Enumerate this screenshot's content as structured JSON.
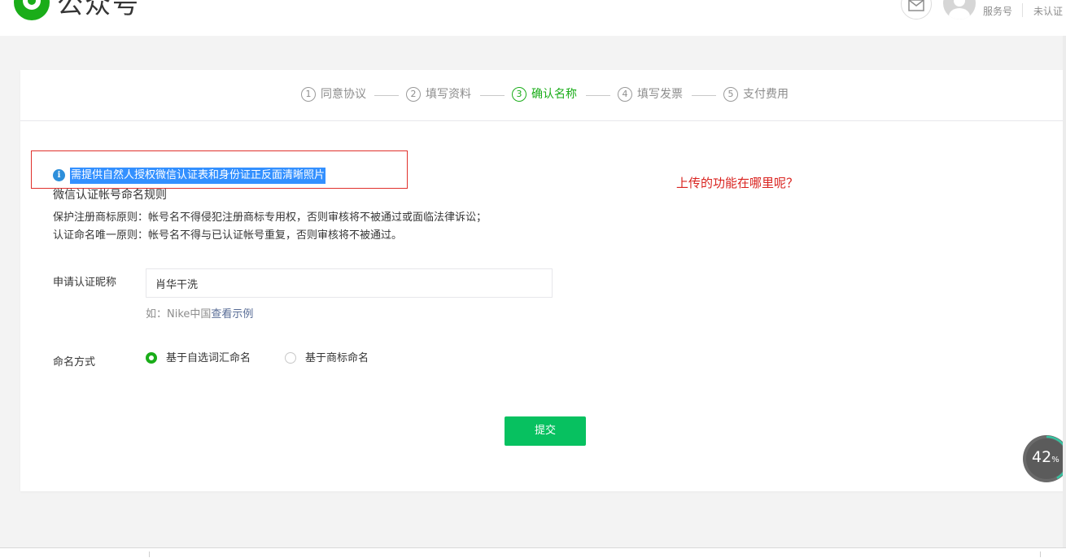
{
  "header": {
    "brand": "公众号",
    "account_type": "服务号",
    "account_status": "未认证"
  },
  "steps": [
    {
      "num": "1",
      "label": "同意协议",
      "active": false
    },
    {
      "num": "2",
      "label": "填写资料",
      "active": false
    },
    {
      "num": "3",
      "label": "确认名称",
      "active": true
    },
    {
      "num": "4",
      "label": "填写发票",
      "active": false
    },
    {
      "num": "5",
      "label": "支付费用",
      "active": false
    }
  ],
  "notice": {
    "text": "需提供自然人授权微信认证表和身份证正反面清晰照片"
  },
  "annotation": "上传的功能在哪里呢？",
  "rules": {
    "title": "微信认证帐号命名规则",
    "lines": [
      "保护注册商标原则：帐号名不得侵犯注册商标专用权，否则审核将不被通过或面临法律诉讼；",
      "认证命名唯一原则：帐号名不得与已认证帐号重复，否则审核将不被通过。"
    ]
  },
  "form": {
    "nickname_label": "申请认证昵称",
    "nickname_value": "肖华干洗",
    "hint_prefix": "如：Nike中国",
    "hint_link": "查看示例",
    "naming_label": "命名方式",
    "naming_options": [
      {
        "label": "基于自选词汇命名",
        "checked": true
      },
      {
        "label": "基于商标命名",
        "checked": false
      }
    ]
  },
  "submit_label": "提交",
  "progress_widget": {
    "value": "42",
    "unit": "%",
    "fraction": 0.42
  },
  "colors": {
    "brand_green": "#1aad19",
    "button_green": "#07c160",
    "annotation_red": "#d9231f",
    "selection_blue": "#3390ff",
    "link_blue": "#576b95"
  }
}
